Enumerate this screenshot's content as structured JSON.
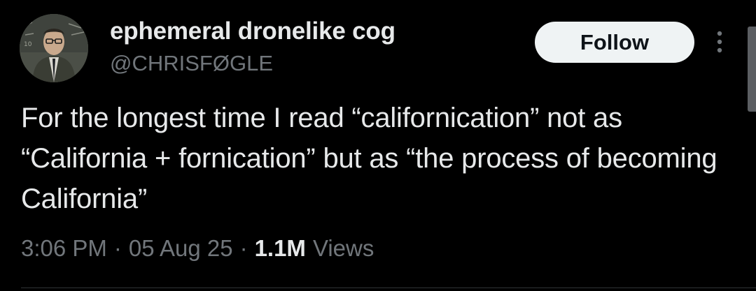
{
  "author": {
    "display_name": "ephemeral dronelike cog",
    "handle": "@CHRISFØGLE",
    "avatar_icon": "profile-photo"
  },
  "actions": {
    "follow_label": "Follow",
    "more_icon": "more-vertical-icon"
  },
  "tweet": {
    "text": "For the longest time I read “californication” not as “California + fornication” but as “the process of becoming California”"
  },
  "meta": {
    "time": "3:06 PM",
    "separator": "·",
    "date": "05 Aug 25",
    "views_count": "1.1M",
    "views_label": "Views"
  },
  "colors": {
    "background": "#000000",
    "primary_text": "#e7e9ea",
    "secondary_text": "#71767b",
    "follow_button_bg": "#eff3f4"
  }
}
